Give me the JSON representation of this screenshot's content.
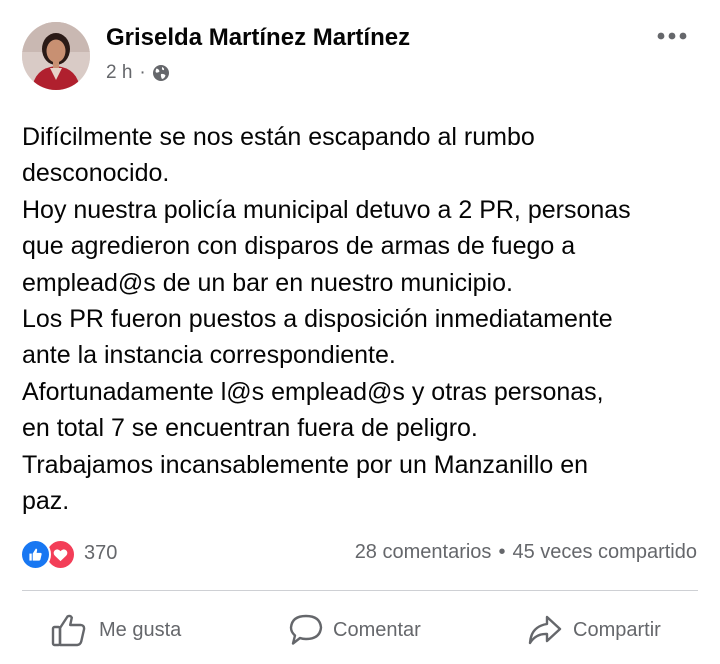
{
  "post": {
    "author": "Griselda Martínez Martínez",
    "time": "2 h",
    "separator": "·",
    "privacy_icon": "globe-icon",
    "more_icon": "more-options-icon",
    "text_lines": [
      "Difícilmente se nos están escapando al rumbo",
      "desconocido.",
      "Hoy nuestra policía municipal detuvo a 2 PR, personas",
      "que agredieron con disparos de armas de fuego a",
      "emplead@s de un bar en nuestro municipio.",
      "Los PR fueron puestos a disposición inmediatamente",
      "ante la instancia correspondiente.",
      "Afortunadamente l@s emplead@s y otras personas,",
      "en total 7 se encuentran fuera de peligro.",
      "Trabajamos incansablemente por un Manzanillo en",
      "paz."
    ]
  },
  "stats": {
    "reactions_count": "370",
    "reaction_icons": [
      "like-reaction-icon",
      "love-reaction-icon"
    ],
    "comments": "28 comentarios",
    "separator": "•",
    "shares": "45 veces compartido"
  },
  "actions": {
    "like": "Me gusta",
    "comment": "Comentar",
    "share": "Compartir"
  },
  "colors": {
    "text_primary": "#050505",
    "text_secondary": "#65676b",
    "like_blue": "#1877f2",
    "love_red": "#f33e58",
    "divider": "#ced0d4"
  }
}
